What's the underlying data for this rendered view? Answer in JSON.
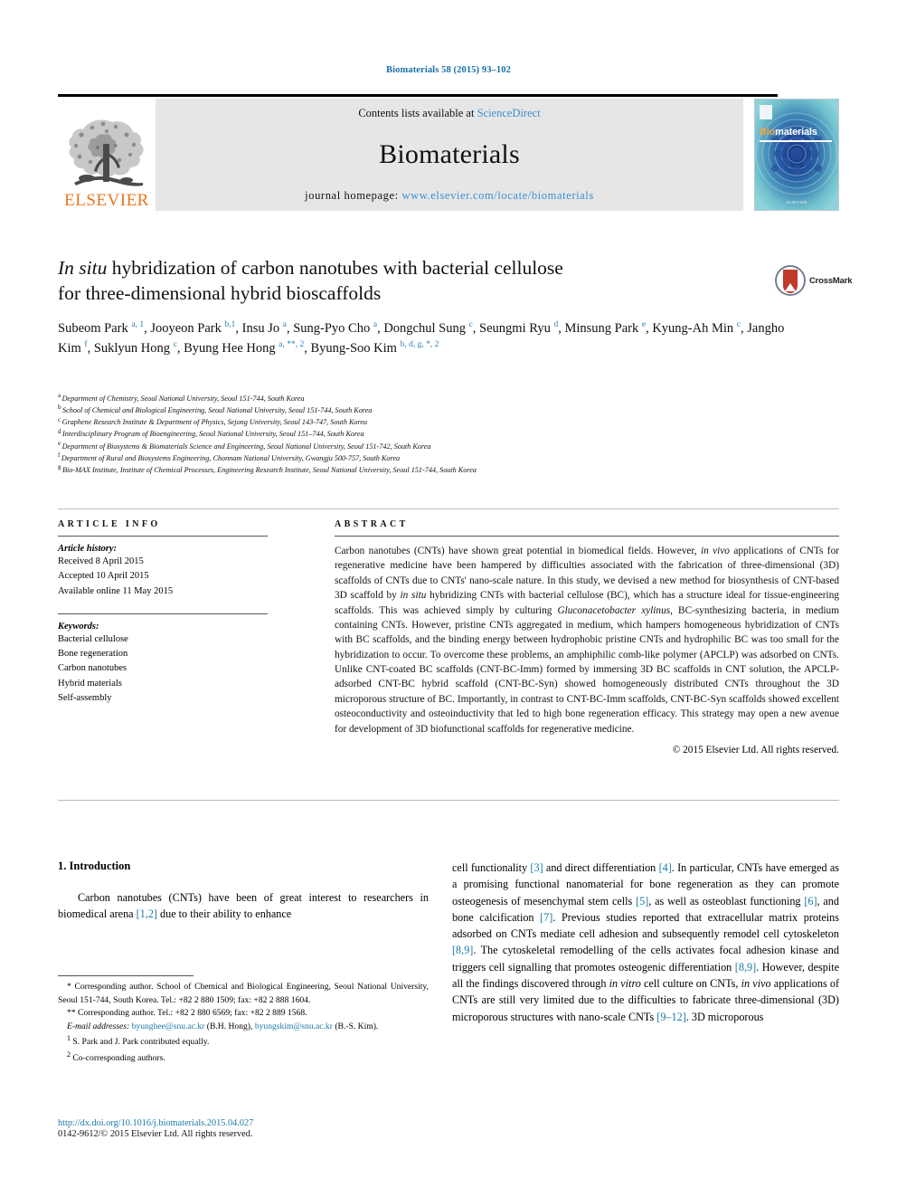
{
  "running_head": "Biomaterials 58 (2015) 93–102",
  "masthead": {
    "contents_prefix": "Contents lists available at ",
    "contents_link": "ScienceDirect",
    "journal_name": "Biomaterials",
    "homepage_prefix": "journal homepage: ",
    "homepage_url": "www.elsevier.com/locate/biomaterials",
    "publisher_word": "ELSEVIER",
    "cover": {
      "label_bio": "Bio",
      "label_materials": "materials",
      "publisher_small": "ELSEVIER"
    }
  },
  "crossmark": {
    "label": "CrossMark"
  },
  "article": {
    "title_line1_italic": "In situ",
    "title_line1_rest": " hybridization of carbon nanotubes with bacterial cellulose",
    "title_line2": "for three-dimensional hybrid bioscaffolds",
    "authors": [
      {
        "name": "Subeom Park",
        "sup": "a, 1",
        "sep": ", "
      },
      {
        "name": "Jooyeon Park",
        "sup": "b,1",
        "sep": ", "
      },
      {
        "name": "Insu Jo",
        "sup": "a",
        "sep": ", "
      },
      {
        "name": "Sung-Pyo Cho",
        "sup": "a",
        "sep": ", "
      },
      {
        "name": "Dongchul Sung",
        "sup": "c",
        "sep": ", "
      },
      {
        "name": "Seungmi Ryu",
        "sup": "d",
        "sep": ", "
      },
      {
        "name": "Minsung Park",
        "sup": "e",
        "sep": ", "
      },
      {
        "name": "Kyung-Ah Min",
        "sup": "c",
        "sep": ", "
      },
      {
        "name": "Jangho Kim",
        "sup": "f",
        "sep": ", "
      },
      {
        "name": "Suklyun Hong",
        "sup": "c",
        "sep": ", "
      },
      {
        "name": "Byung Hee Hong",
        "sup": "a, **, 2",
        "sep": ", "
      },
      {
        "name": "Byung-Soo Kim",
        "sup": "b, d, g, *, 2",
        "sep": ""
      }
    ],
    "affiliations": [
      {
        "mark": "a",
        "text": "Department of Chemistry, Seoul National University, Seoul 151-744, South Korea"
      },
      {
        "mark": "b",
        "text": "School of Chemical and Biological Engineering, Seoul National University, Seoul 151-744, South Korea"
      },
      {
        "mark": "c",
        "text": "Graphene Research Institute & Department of Physics, Sejong University, Seoul 143-747, South Korea"
      },
      {
        "mark": "d",
        "text": "Interdisciplinary Program of Bioengineering, Seoul National University, Seoul 151–744, South Korea"
      },
      {
        "mark": "e",
        "text": "Department of Biosystems & Biomaterials Science and Engineering, Seoul National University, Seoul 151-742, South Korea"
      },
      {
        "mark": "f",
        "text": "Department of Rural and Biosystems Engineering, Chonnam National University, Gwangju 500-757, South Korea"
      },
      {
        "mark": "g",
        "text": "Bio-MAX Institute, Institute of Chemical Processes, Engineering Research Institute, Seoul National University, Seoul 151-744, South Korea"
      }
    ]
  },
  "article_info": {
    "heading": "ARTICLE INFO",
    "history_label": "Article history:",
    "history": [
      "Received 8 April 2015",
      "Accepted 10 April 2015",
      "Available online 11 May 2015"
    ],
    "keywords_label": "Keywords:",
    "keywords": [
      "Bacterial cellulose",
      "Bone regeneration",
      "Carbon nanotubes",
      "Hybrid materials",
      "Self-assembly"
    ]
  },
  "abstract": {
    "heading": "ABSTRACT",
    "paragraph_1": "Carbon nanotubes (CNTs) have shown great potential in biomedical fields. However, ",
    "em_1": "in vivo",
    "paragraph_2": " applications of CNTs for regenerative medicine have been hampered by difficulties associated with the fabrication of three-dimensional (3D) scaffolds of CNTs due to CNTs' nano-scale nature. In this study, we devised a new method for biosynthesis of CNT-based 3D scaffold by ",
    "em_2": "in situ",
    "paragraph_3": " hybridizing CNTs with bacterial cellulose (BC), which has a structure ideal for tissue-engineering scaffolds. This was achieved simply by culturing ",
    "em_3": "Gluconacetobacter xylinus",
    "paragraph_4": ", BC-synthesizing bacteria, in medium containing CNTs. However, pristine CNTs aggregated in medium, which hampers homogeneous hybridization of CNTs with BC scaffolds, and the binding energy between hydrophobic pristine CNTs and hydrophilic BC was too small for the hybridization to occur. To overcome these problems, an amphiphilic comb-like polymer (APCLP) was adsorbed on CNTs. Unlike CNT-coated BC scaffolds (CNT-BC-Imm) formed by immersing 3D BC scaffolds in CNT solution, the APCLP-adsorbed CNT-BC hybrid scaffold (CNT-BC-Syn) showed homogeneously distributed CNTs throughout the 3D microporous structure of BC. Importantly, in contrast to CNT-BC-Imm scaffolds, CNT-BC-Syn scaffolds showed excellent osteoconductivity and osteoinductivity that led to high bone regeneration efficacy. This strategy may open a new avenue for development of 3D biofunctional scaffolds for regenerative medicine.",
    "copyright": "© 2015 Elsevier Ltd. All rights reserved."
  },
  "introduction": {
    "heading": "1.  Introduction",
    "left_para_1": "Carbon nanotubes (CNTs) have been of great interest to researchers in biomedical arena ",
    "left_ref_1": "[1,2]",
    "left_para_2": " due to their ability to enhance",
    "right_segments": [
      {
        "t": "cell functionality "
      },
      {
        "r": "[3]"
      },
      {
        "t": " and direct differentiation "
      },
      {
        "r": "[4]"
      },
      {
        "t": ". In particular, CNTs have emerged as a promising functional nanomaterial for bone regeneration as they can promote osteogenesis of mesenchymal stem cells "
      },
      {
        "r": "[5]"
      },
      {
        "t": ", as well as osteoblast functioning "
      },
      {
        "r": "[6]"
      },
      {
        "t": ", and bone calcification "
      },
      {
        "r": "[7]"
      },
      {
        "t": ". Previous studies reported that extracellular matrix proteins adsorbed on CNTs mediate cell adhesion and subsequently remodel cell cytoskeleton "
      },
      {
        "r": "[8,9]"
      },
      {
        "t": ". The cytoskeletal remodelling of the cells activates focal adhesion kinase and triggers cell signalling that promotes osteogenic differentiation "
      },
      {
        "r": "[8,9]"
      },
      {
        "t": ". However, despite all the findings discovered through "
      },
      {
        "i": "in vitro"
      },
      {
        "t": " cell culture on CNTs, "
      },
      {
        "i": "in vivo"
      },
      {
        "t": " applications of CNTs are still very limited due to the difficulties to fabricate three-dimensional (3D) microporous structures with nano-scale CNTs "
      },
      {
        "r": "[9–12]"
      },
      {
        "t": ". 3D microporous"
      }
    ]
  },
  "footnotes": {
    "line_1_mark": "*",
    "line_1": " Corresponding author. School of Chemical and Biological Engineering, Seoul National University, Seoul 151-744, South Korea. Tel.: +82 2 880 1509; fax: +82 2 888 1604.",
    "line_2_mark": "**",
    "line_2": " Corresponding author. Tel.: +82 2 880 6569; fax: +82 2 889 1568.",
    "email_label": "E-mail addresses:",
    "email_1": "byunghee@snu.ac.kr",
    "email_1_owner": " (B.H. Hong), ",
    "email_2": "byungskim@snu.ac.kr",
    "email_2_owner": " (B.-S. Kim).",
    "note_1_mark": "1",
    "note_1": " S. Park and J. Park contributed equally.",
    "note_2_mark": "2",
    "note_2": " Co-corresponding authors."
  },
  "footer": {
    "doi": "http://dx.doi.org/10.1016/j.biomaterials.2015.04.027",
    "issn": "0142-9612/© 2015 Elsevier Ltd. All rights reserved."
  },
  "colors": {
    "link": "#1a7aa8",
    "elsevier_orange": "#E87722",
    "masthead_bg": "#e6e6e6",
    "cover_teal": "#59b3c4"
  }
}
